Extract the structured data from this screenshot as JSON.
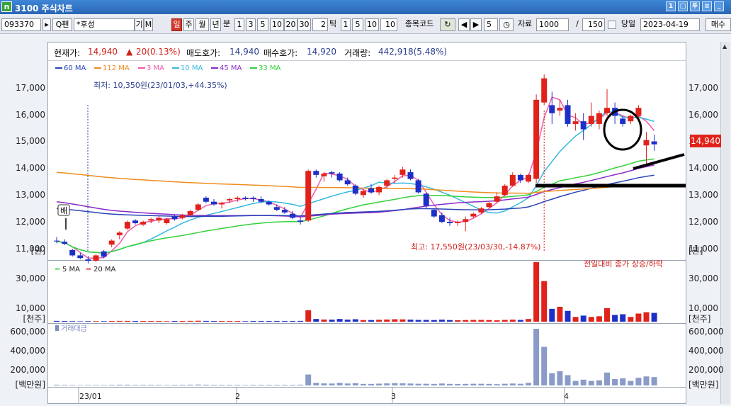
{
  "window": {
    "title": "3100 주식차트",
    "logo": "n"
  },
  "toolbar": {
    "code": "093370",
    "name": "*후성",
    "gi": "기",
    "m": "M",
    "periods": [
      "일",
      "주",
      "월",
      "년"
    ],
    "bun": "분",
    "minutes": [
      "1",
      "3",
      "5",
      "10",
      "20",
      "30"
    ],
    "tick_value": "2",
    "tick_label": "틱",
    "tick_opts": [
      "1",
      "5",
      "10"
    ],
    "tick_field": "10",
    "code_label": "종목코드",
    "step": "5",
    "data_label": "자료",
    "data_count": "1000",
    "slash": "/",
    "visible": "150",
    "today_label": "당일",
    "date": "2023-04-19",
    "action": "매수"
  },
  "info": {
    "cur_label": "현재가:",
    "cur": "14,940",
    "chg": "20(0.13%)",
    "ask_label": "매도호가:",
    "ask": "14,940",
    "bid_label": "매수호가:",
    "bid": "14,920",
    "vol_label": "거래량:",
    "vol": "442,918(5.48%)"
  },
  "annotations": {
    "low": "최저: 10,350원(23/01/03,+44.35%)",
    "high": "최고: 17,550원(23/03/30,-14.87%)",
    "vol_note": "전일대비 종가 상승/하락",
    "bae": "배",
    "price_tag": "14,940"
  },
  "price_axis": {
    "ticks": [
      "17,000",
      "16,000",
      "15,000",
      "14,000",
      "13,000",
      "12,000",
      "11,000"
    ],
    "unit": "[원]"
  },
  "volume_axis": {
    "ticks": [
      "30,000",
      "10,000"
    ],
    "unit": "[천주]"
  },
  "amount_axis": {
    "ticks": [
      "600,000",
      "400,000",
      "200,000"
    ],
    "unit": "[백만원]",
    "legend": "거래대금"
  },
  "date_labels": [
    "23/01",
    "2",
    "3",
    "4"
  ],
  "colors": {
    "up": "#e0221b",
    "down": "#1e2fc8",
    "ma60": "#2a45b8",
    "ma112": "#f08c1e",
    "ma3": "#f25aa8",
    "ma10": "#35b8de",
    "ma45": "#8a2bc8",
    "ma33": "#34d13a"
  },
  "chart_data": {
    "type": "candlestick",
    "price_ylim": [
      10600,
      17600
    ],
    "legend": [
      "60 MA",
      "112 MA",
      "3 MA",
      "10 MA",
      "45 MA",
      "33 MA"
    ],
    "vol_legend": [
      "5 MA",
      "20 MA"
    ],
    "candles": [
      [
        11350,
        11480,
        11250,
        11320
      ],
      [
        11310,
        11400,
        11180,
        11230
      ],
      [
        11000,
        11050,
        10750,
        10800
      ],
      [
        10800,
        10900,
        10650,
        10700
      ],
      [
        10650,
        10780,
        10500,
        10600
      ],
      [
        10600,
        10850,
        10550,
        10800
      ],
      [
        10950,
        11000,
        10700,
        10750
      ],
      [
        11200,
        11400,
        11100,
        11350
      ],
      [
        11550,
        11700,
        11400,
        11650
      ],
      [
        11800,
        12100,
        11750,
        12050
      ],
      [
        12100,
        12150,
        11950,
        12000
      ],
      [
        11950,
        12100,
        11900,
        12050
      ],
      [
        12100,
        12200,
        12000,
        12150
      ],
      [
        12100,
        12250,
        12000,
        12200
      ],
      [
        12000,
        12200,
        11950,
        12150
      ],
      [
        12250,
        12300,
        12100,
        12150
      ],
      [
        12200,
        12350,
        12150,
        12300
      ],
      [
        12300,
        12500,
        12250,
        12450
      ],
      [
        12500,
        12750,
        12450,
        12700
      ],
      [
        12950,
        13000,
        12750,
        12800
      ],
      [
        12800,
        12900,
        12650,
        12700
      ],
      [
        12700,
        12800,
        12550,
        12750
      ],
      [
        12850,
        12950,
        12750,
        12900
      ],
      [
        12900,
        13000,
        12800,
        12950
      ],
      [
        12950,
        13000,
        12850,
        12900
      ],
      [
        12950,
        13000,
        12800,
        12900
      ],
      [
        12900,
        13000,
        12750,
        12800
      ],
      [
        12800,
        12850,
        12650,
        12700
      ],
      [
        12600,
        12700,
        12450,
        12500
      ],
      [
        12500,
        12600,
        12350,
        12400
      ],
      [
        12350,
        12450,
        12150,
        12200
      ],
      [
        12100,
        12200,
        11950,
        12050
      ],
      [
        12100,
        14000,
        12050,
        13950
      ],
      [
        13950,
        14000,
        13700,
        13800
      ],
      [
        13750,
        13900,
        13550,
        13850
      ],
      [
        13900,
        13950,
        13700,
        13850
      ],
      [
        13850,
        13900,
        13550,
        13600
      ],
      [
        13600,
        13700,
        13400,
        13450
      ],
      [
        13400,
        13450,
        13050,
        13100
      ],
      [
        13050,
        13250,
        12950,
        13200
      ],
      [
        13300,
        13450,
        13100,
        13150
      ],
      [
        13150,
        13400,
        13050,
        13350
      ],
      [
        13400,
        13650,
        13300,
        13600
      ],
      [
        13650,
        13800,
        13500,
        13700
      ],
      [
        13800,
        14100,
        13700,
        14000
      ],
      [
        13900,
        14000,
        13600,
        13650
      ],
      [
        13600,
        13650,
        13100,
        13150
      ],
      [
        13100,
        13150,
        12550,
        12650
      ],
      [
        12500,
        12550,
        12200,
        12250
      ],
      [
        12300,
        12400,
        12000,
        12050
      ],
      [
        12050,
        12200,
        11900,
        12000
      ],
      [
        12000,
        12100,
        11900,
        12050
      ],
      [
        12050,
        12250,
        11700,
        12150
      ],
      [
        12250,
        12400,
        12200,
        12350
      ],
      [
        12400,
        12600,
        12350,
        12550
      ],
      [
        12600,
        12800,
        12550,
        12750
      ],
      [
        12800,
        13150,
        12750,
        13000
      ],
      [
        13050,
        13450,
        13000,
        13400
      ],
      [
        13400,
        13900,
        13350,
        13800
      ],
      [
        13800,
        13850,
        13500,
        13600
      ],
      [
        13550,
        13850,
        13500,
        13800
      ],
      [
        13650,
        16800,
        13500,
        16600
      ],
      [
        16500,
        17550,
        16400,
        17400
      ],
      [
        16400,
        16900,
        15700,
        16100
      ],
      [
        16200,
        16600,
        16000,
        16300
      ],
      [
        16400,
        16600,
        15600,
        15700
      ],
      [
        15700,
        16100,
        15450,
        15800
      ],
      [
        15800,
        16100,
        15100,
        15500
      ],
      [
        15700,
        16500,
        15600,
        16000
      ],
      [
        15700,
        16200,
        15500,
        16100
      ],
      [
        16100,
        17000,
        16000,
        16300
      ],
      [
        16300,
        16500,
        15700,
        16000
      ],
      [
        15900,
        16000,
        15600,
        15700
      ],
      [
        15800,
        16050,
        15700,
        16000
      ],
      [
        16000,
        16400,
        15900,
        16300
      ],
      [
        14900,
        15400,
        14200,
        15100
      ],
      [
        15050,
        15300,
        14700,
        14940
      ]
    ],
    "volumes": [
      0.6,
      0.5,
      0.4,
      0.3,
      0.4,
      0.4,
      0.4,
      0.5,
      0.6,
      0.6,
      0.5,
      0.5,
      0.5,
      0.5,
      0.4,
      0.5,
      0.5,
      0.6,
      0.7,
      0.6,
      0.5,
      0.5,
      0.5,
      0.5,
      0.4,
      0.5,
      0.5,
      0.5,
      0.5,
      0.5,
      0.5,
      0.6,
      8.5,
      2.0,
      1.6,
      1.5,
      2.0,
      1.5,
      1.8,
      1.2,
      1.2,
      1.4,
      1.6,
      1.8,
      1.7,
      1.5,
      1.3,
      1.3,
      1.2,
      1.5,
      1.2,
      1.1,
      1.2,
      1.3,
      1.3,
      1.2,
      1.0,
      1.3,
      1.5,
      1.3,
      2.0,
      44.0,
      30.0,
      9.5,
      11.0,
      8.0,
      3.5,
      4.5,
      3.5,
      4.0,
      10.0,
      5.0,
      5.5,
      3.5,
      6.0,
      7.0,
      6.5
    ]
  }
}
